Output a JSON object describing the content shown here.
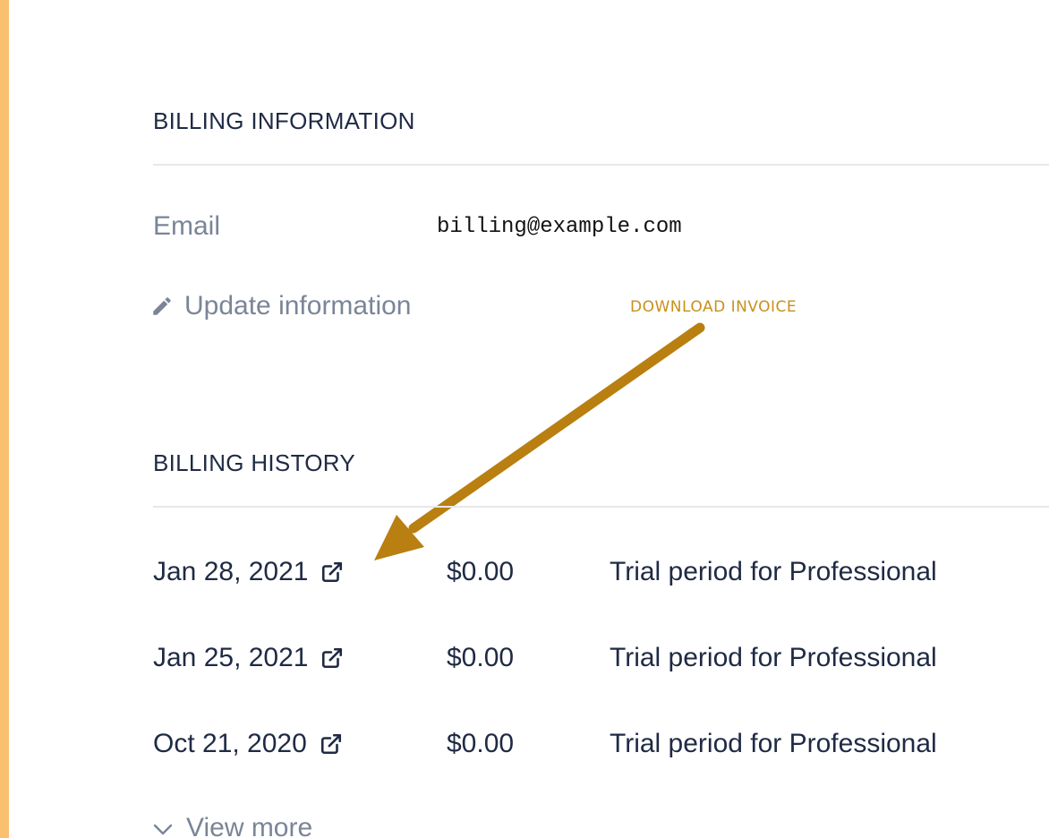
{
  "billing_information": {
    "title": "BILLING INFORMATION",
    "email_label": "Email",
    "email_value": "billing@example.com",
    "update_link": "Update information"
  },
  "billing_history": {
    "title": "BILLING HISTORY",
    "rows": [
      {
        "date": "Jan 28, 2021",
        "amount": "$0.00",
        "description": "Trial period for Professional"
      },
      {
        "date": "Jan 25, 2021",
        "amount": "$0.00",
        "description": "Trial period for Professional"
      },
      {
        "date": "Oct 21, 2020",
        "amount": "$0.00",
        "description": "Trial period for Professional"
      }
    ],
    "view_more": "View more"
  },
  "annotation": {
    "label": "DOWNLOAD INVOICE",
    "color": "#b97f10"
  },
  "colors": {
    "accent_bar": "#fbbf72",
    "text_primary": "#1f2a44",
    "text_muted": "#7a8597"
  },
  "icons": {
    "edit": "pencil-icon",
    "external": "external-link-icon",
    "expand": "chevron-down-icon"
  }
}
